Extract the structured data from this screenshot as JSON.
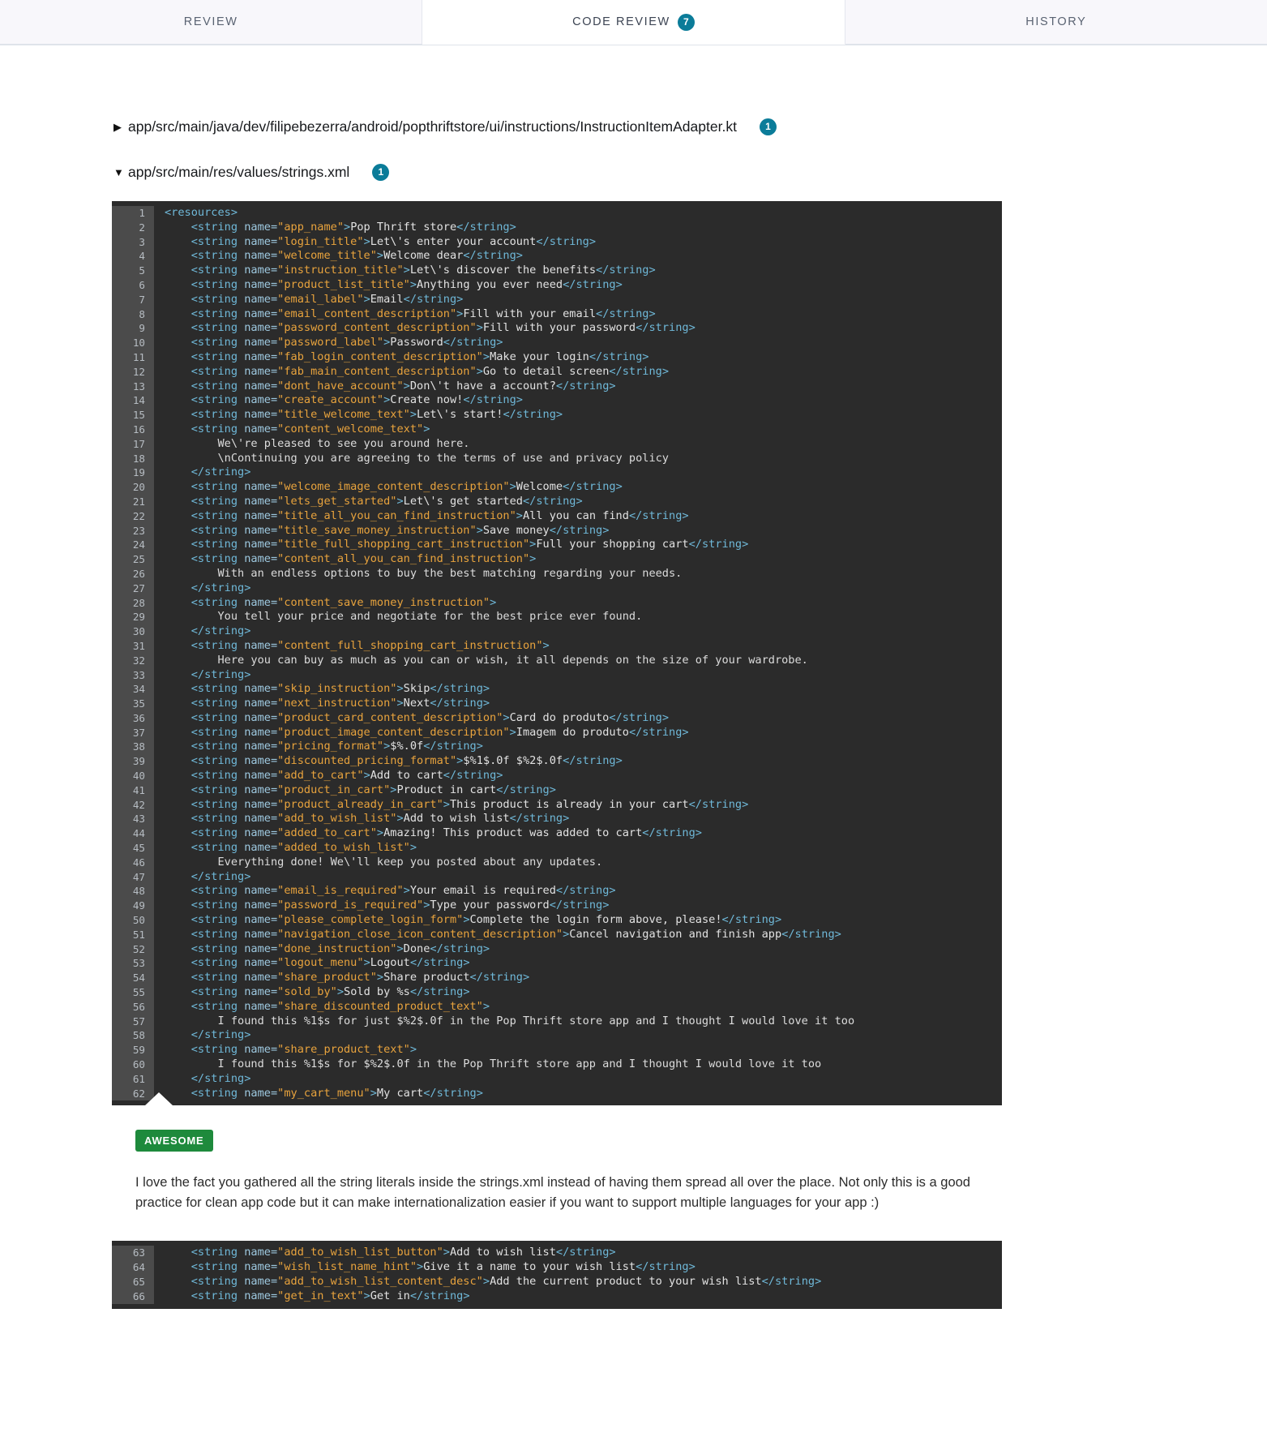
{
  "tabs": [
    {
      "label": "REVIEW",
      "badge": null,
      "active": false
    },
    {
      "label": "CODE REVIEW",
      "badge": "7",
      "active": true
    },
    {
      "label": "HISTORY",
      "badge": null,
      "active": false
    }
  ],
  "files": [
    {
      "caret": "▶",
      "path": "app/src/main/java/dev/filipebezerra/android/popthriftstore/ui/instructions/InstructionItemAdapter.kt",
      "badge": "1",
      "expanded": false
    },
    {
      "caret": "▼",
      "path": "app/src/main/res/values/strings.xml",
      "badge": "1",
      "expanded": true
    }
  ],
  "code_top": {
    "first_line": 1,
    "lines": [
      "<resources>",
      "    <string name=\"app_name\">Pop Thrift store</string>",
      "    <string name=\"login_title\">Let\\'s enter your account</string>",
      "    <string name=\"welcome_title\">Welcome dear</string>",
      "    <string name=\"instruction_title\">Let\\'s discover the benefits</string>",
      "    <string name=\"product_list_title\">Anything you ever need</string>",
      "    <string name=\"email_label\">Email</string>",
      "    <string name=\"email_content_description\">Fill with your email</string>",
      "    <string name=\"password_content_description\">Fill with your password</string>",
      "    <string name=\"password_label\">Password</string>",
      "    <string name=\"fab_login_content_description\">Make your login</string>",
      "    <string name=\"fab_main_content_description\">Go to detail screen</string>",
      "    <string name=\"dont_have_account\">Don\\'t have a account?</string>",
      "    <string name=\"create_account\">Create now!</string>",
      "    <string name=\"title_welcome_text\">Let\\'s start!</string>",
      "    <string name=\"content_welcome_text\">",
      "        We\\'re pleased to see you around here.",
      "        \\nContinuing you are agreeing to the terms of use and privacy policy",
      "    </string>",
      "    <string name=\"welcome_image_content_description\">Welcome</string>",
      "    <string name=\"lets_get_started\">Let\\'s get started</string>",
      "    <string name=\"title_all_you_can_find_instruction\">All you can find</string>",
      "    <string name=\"title_save_money_instruction\">Save money</string>",
      "    <string name=\"title_full_shopping_cart_instruction\">Full your shopping cart</string>",
      "    <string name=\"content_all_you_can_find_instruction\">",
      "        With an endless options to buy the best matching regarding your needs.",
      "    </string>",
      "    <string name=\"content_save_money_instruction\">",
      "        You tell your price and negotiate for the best price ever found.",
      "    </string>",
      "    <string name=\"content_full_shopping_cart_instruction\">",
      "        Here you can buy as much as you can or wish, it all depends on the size of your wardrobe.",
      "    </string>",
      "    <string name=\"skip_instruction\">Skip</string>",
      "    <string name=\"next_instruction\">Next</string>",
      "    <string name=\"product_card_content_description\">Card do produto</string>",
      "    <string name=\"product_image_content_description\">Imagem do produto</string>",
      "    <string name=\"pricing_format\">$%.0f</string>",
      "    <string name=\"discounted_pricing_format\">$%1$.0f $%2$.0f</string>",
      "    <string name=\"add_to_cart\">Add to cart</string>",
      "    <string name=\"product_in_cart\">Product in cart</string>",
      "    <string name=\"product_already_in_cart\">This product is already in your cart</string>",
      "    <string name=\"add_to_wish_list\">Add to wish list</string>",
      "    <string name=\"added_to_cart\">Amazing! This product was added to cart</string>",
      "    <string name=\"added_to_wish_list\">",
      "        Everything done! We\\'ll keep you posted about any updates.",
      "    </string>",
      "    <string name=\"email_is_required\">Your email is required</string>",
      "    <string name=\"password_is_required\">Type your password</string>",
      "    <string name=\"please_complete_login_form\">Complete the login form above, please!</string>",
      "    <string name=\"navigation_close_icon_content_description\">Cancel navigation and finish app</string>",
      "    <string name=\"done_instruction\">Done</string>",
      "    <string name=\"logout_menu\">Logout</string>",
      "    <string name=\"share_product\">Share product</string>",
      "    <string name=\"sold_by\">Sold by %s</string>",
      "    <string name=\"share_discounted_product_text\">",
      "        I found this %1$s for just $%2$.0f in the Pop Thrift store app and I thought I would love it too",
      "    </string>",
      "    <string name=\"share_product_text\">",
      "        I found this %1$s for $%2$.0f in the Pop Thrift store app and I thought I would love it too",
      "    </string>",
      "    <string name=\"my_cart_menu\">My cart</string>"
    ]
  },
  "comment": {
    "badge": "AWESOME",
    "badge_color": "#1e8a3c",
    "text": "I love the fact you gathered all the string literals inside the strings.xml instead of having them spread all over the place. Not only this is a good practice for clean app code but it can make internationalization easier if you want to support multiple languages for your app :)"
  },
  "code_bottom": {
    "first_line": 63,
    "lines": [
      "    <string name=\"add_to_wish_list_button\">Add to wish list</string>",
      "    <string name=\"wish_list_name_hint\">Give it a name to your wish list</string>",
      "    <string name=\"add_to_wish_list_content_desc\">Add the current product to your wish list</string>",
      "    <string name=\"get_in_text\">Get in</string>"
    ]
  },
  "colors": {
    "accent": "#0b7c99",
    "code_bg": "#2b2b2b",
    "gutter_bg": "#4b4b4b",
    "tag": "#6fb8d8",
    "attr": "#9ec9e0",
    "string": "#e8a33d",
    "text": "#e2e2e2",
    "badge_green": "#1e8a3c"
  }
}
